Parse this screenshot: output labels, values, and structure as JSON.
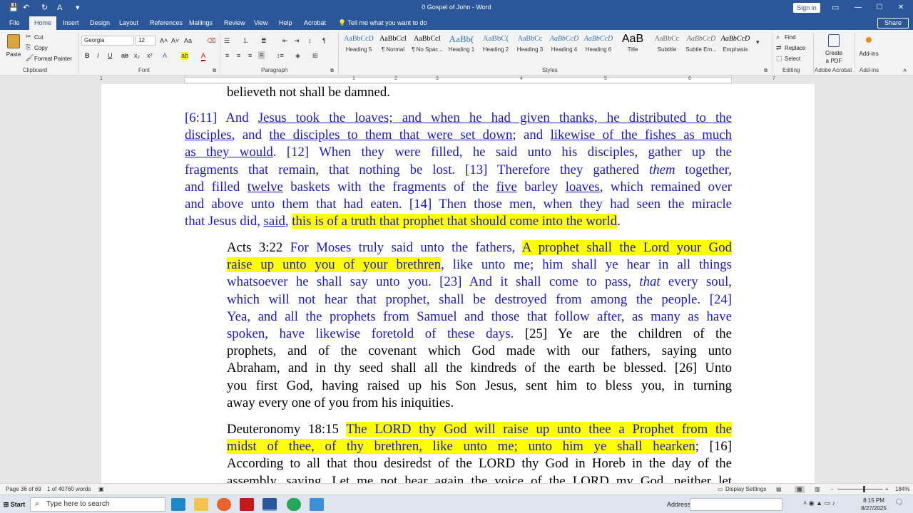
{
  "window": {
    "title": "0 Gospel of John  -  Word",
    "sign_in": "Sign in",
    "minimize": "—",
    "maximize": "☐",
    "close": "✕"
  },
  "tabs": [
    "File",
    "Home",
    "Insert",
    "Design",
    "Layout",
    "References",
    "Mailings",
    "Review",
    "View",
    "Help",
    "Acrobat"
  ],
  "active_tab": "Home",
  "tell_me": "Tell me what you want to do",
  "share": "Share",
  "ribbon": {
    "clipboard": {
      "label": "Clipboard",
      "paste": "Paste",
      "cut": "Cut",
      "copy": "Copy",
      "format_painter": "Format Painter"
    },
    "font": {
      "label": "Font",
      "name": "Georgia",
      "size": "12"
    },
    "paragraph": {
      "label": "Paragraph"
    },
    "styles": {
      "label": "Styles",
      "items": [
        {
          "preview": "AaBbCcD",
          "name": "Heading 5"
        },
        {
          "preview": "AaBbCcI",
          "name": "¶ Normal"
        },
        {
          "preview": "AaBbCcI",
          "name": "¶ No Spac..."
        },
        {
          "preview": "AaBb(",
          "name": "Heading 1"
        },
        {
          "preview": "AaBbC(",
          "name": "Heading 2"
        },
        {
          "preview": "AaBbCc",
          "name": "Heading 3"
        },
        {
          "preview": "AaBbCcD",
          "name": "Heading 4"
        },
        {
          "preview": "AaBbCcD",
          "name": "Heading 6"
        },
        {
          "preview": "AaB",
          "name": "Title"
        },
        {
          "preview": "AaBbCc",
          "name": "Subtitle"
        },
        {
          "preview": "AaBbCcD",
          "name": "Subtle Em..."
        },
        {
          "preview": "AaBbCcD",
          "name": "Emphasis"
        }
      ]
    },
    "editing": {
      "label": "Editing",
      "find": "Find",
      "replace": "Replace",
      "select": "Select"
    },
    "acrobat": {
      "label": "Adobe Acrobat",
      "create": "Create",
      "pdf": "a PDF"
    },
    "addins": {
      "label": "Add-ins",
      "button": "Add-ins"
    }
  },
  "ruler_numbers": [
    "1",
    "1",
    "2",
    "3",
    "4",
    "5",
    "6",
    "7"
  ],
  "document": {
    "p0": "believeth not shall be damned.",
    "p1": [
      [
        {
          "t": "[6:11] And ",
          "s": "blue"
        },
        {
          "t": "Jesus took the loaves; and when he had given thanks, he distributed to the",
          "s": "blue u"
        }
      ],
      [
        {
          "t": "disciples",
          "s": "blue u"
        },
        {
          "t": ", and ",
          "s": "blue"
        },
        {
          "t": "the disciples to them that were set down",
          "s": "blue u"
        },
        {
          "t": "; and ",
          "s": "blue"
        },
        {
          "t": "likewise of the fishes as much",
          "s": "blue u"
        }
      ],
      [
        {
          "t": "as they would",
          "s": "blue u"
        },
        {
          "t": ". [12] When they were filled, he said unto his disciples, gather up the",
          "s": "blue"
        }
      ],
      [
        {
          "t": "fragments that remain, that nothing be lost. [13] Therefore they gathered ",
          "s": "blue"
        },
        {
          "t": "them",
          "s": "blue i"
        },
        {
          "t": " together,",
          "s": "blue"
        }
      ],
      [
        {
          "t": "and filled ",
          "s": "blue"
        },
        {
          "t": "twelve",
          "s": "blue u"
        },
        {
          "t": " baskets with the fragments of the ",
          "s": "blue"
        },
        {
          "t": "five",
          "s": "blue u"
        },
        {
          "t": " barley ",
          "s": "blue"
        },
        {
          "t": "loaves",
          "s": "blue u"
        },
        {
          "t": ", which remained over",
          "s": "blue"
        }
      ],
      [
        {
          "t": "and above unto them that had eaten. [14] Then those men, when they had seen the miracle",
          "s": "blue"
        }
      ],
      [
        {
          "t": "that Jesus did, ",
          "s": "blue"
        },
        {
          "t": "said",
          "s": "blue u"
        },
        {
          "t": ", ",
          "s": "blue"
        },
        {
          "t": "this is of a truth that prophet that should come into the world",
          "s": "blue hl"
        },
        {
          "t": ".",
          "s": ""
        }
      ]
    ],
    "p2": [
      [
        {
          "t": "Acts 3:22 ",
          "s": ""
        },
        {
          "t": "For Moses truly said unto the fathers, ",
          "s": "blue"
        },
        {
          "t": "A prophet shall the Lord your God",
          "s": "blue hl"
        }
      ],
      [
        {
          "t": "raise up unto you of your brethren",
          "s": "blue hl"
        },
        {
          "t": ", like unto me; him shall ye hear in all things",
          "s": "blue"
        }
      ],
      [
        {
          "t": "whatsoever he shall say unto you. [23] And it shall come to pass, ",
          "s": "blue"
        },
        {
          "t": "that",
          "s": "blue i"
        },
        {
          "t": " every soul,",
          "s": "blue"
        }
      ],
      [
        {
          "t": "which will not hear that prophet, shall be destroyed from among the people. [24]",
          "s": "blue"
        }
      ],
      [
        {
          "t": "Yea, and all the prophets from Samuel and those that follow after, as many as have",
          "s": "blue"
        }
      ],
      [
        {
          "t": "spoken, have likewise foretold of these days.",
          "s": "blue"
        },
        {
          "t": " [25] Ye are the children of the",
          "s": ""
        }
      ],
      [
        {
          "t": "prophets, and of the covenant which God made with our fathers, saying unto",
          "s": ""
        }
      ],
      [
        {
          "t": "Abraham, and in thy seed shall all the kindreds of the earth be blessed. [26] Unto",
          "s": ""
        }
      ],
      [
        {
          "t": "you first God, having raised up his Son Jesus, sent him to bless you, in turning",
          "s": ""
        }
      ],
      [
        {
          "t": "away every one of you from his iniquities.",
          "s": "last"
        }
      ]
    ],
    "p3": [
      [
        {
          "t": "Deuteronomy 18:15 ",
          "s": ""
        },
        {
          "t": "The LORD thy God will raise up unto thee a Prophet from the",
          "s": "blue hl"
        }
      ],
      [
        {
          "t": "midst of thee, of thy brethren, like unto me; unto him ye shall hearken",
          "s": "blue hl"
        },
        {
          "t": "; [16]",
          "s": ""
        }
      ],
      [
        {
          "t": "According to all that thou desiredst of the LORD thy God in Horeb in the day of the",
          "s": ""
        }
      ],
      [
        {
          "t": "assembly, saying, Let me not hear again the voice of the LORD my God, neither let",
          "s": ""
        }
      ]
    ]
  },
  "status": {
    "page": "Page 36 of 69",
    "words": "1 of 40760 words",
    "display_settings": "Display Settings",
    "zoom": "184%"
  },
  "taskbar": {
    "start": "Start",
    "search_placeholder": "Type here to search",
    "address": "Address",
    "time": "8:15 PM",
    "date": "8/27/2025"
  }
}
